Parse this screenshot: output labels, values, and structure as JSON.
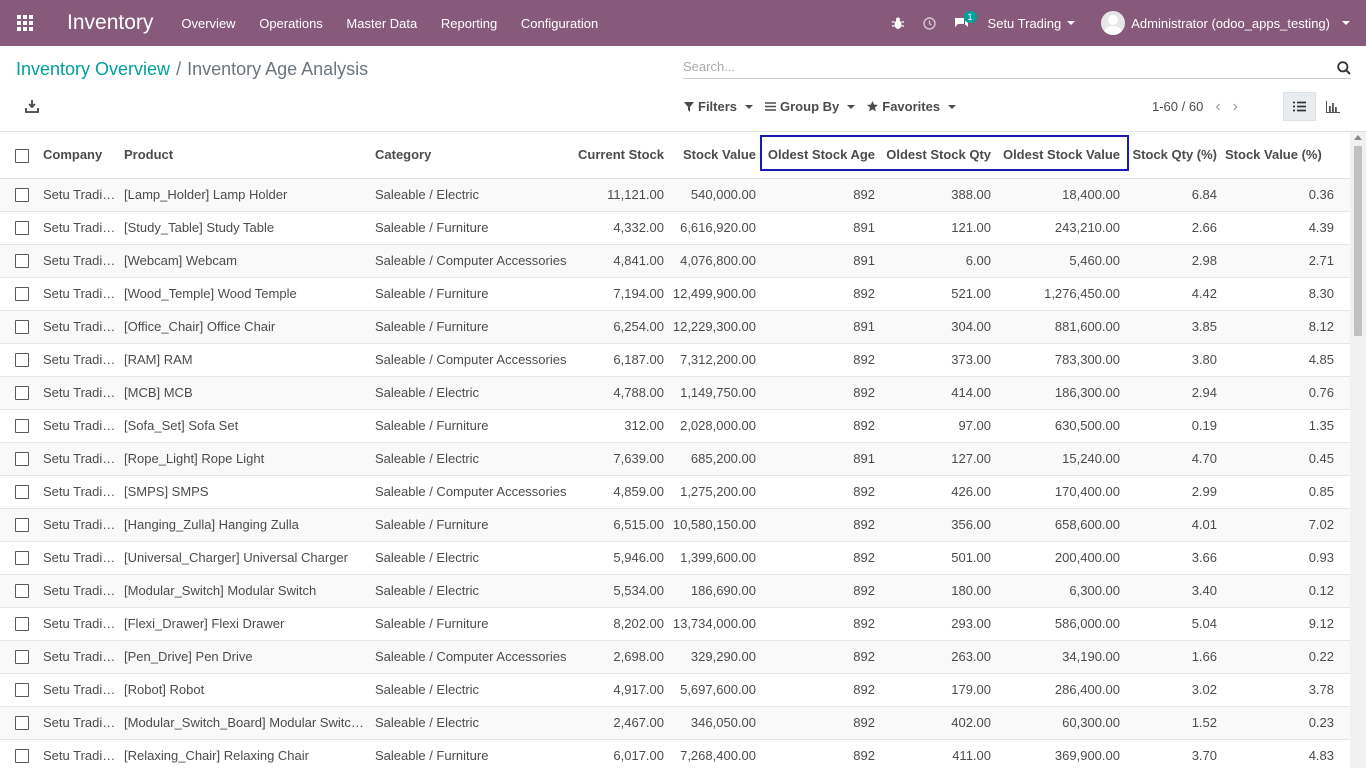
{
  "navbar": {
    "app_title": "Inventory",
    "menu": [
      "Overview",
      "Operations",
      "Master Data",
      "Reporting",
      "Configuration"
    ],
    "message_count": "1",
    "company": "Setu Trading",
    "user": "Administrator (odoo_apps_testing)"
  },
  "breadcrumb": {
    "parent": "Inventory Overview",
    "current": "Inventory Age Analysis"
  },
  "search": {
    "placeholder": "Search..."
  },
  "filters": {
    "filters_label": "Filters",
    "groupby_label": "Group By",
    "favorites_label": "Favorites"
  },
  "pager": {
    "value": "1-60 / 60"
  },
  "table": {
    "columns": [
      "Company",
      "Product",
      "Category",
      "Current Stock",
      "Stock Value",
      "Oldest Stock Age",
      "Oldest Stock Qty",
      "Oldest Stock Value",
      "Stock Qty (%)",
      "Stock Value (%)"
    ],
    "rows": [
      [
        "Setu Trading",
        "[Lamp_Holder] Lamp Holder",
        "Saleable / Electric",
        "11,121.00",
        "540,000.00",
        "892",
        "388.00",
        "18,400.00",
        "6.84",
        "0.36"
      ],
      [
        "Setu Trading",
        "[Study_Table] Study Table",
        "Saleable / Furniture",
        "4,332.00",
        "6,616,920.00",
        "891",
        "121.00",
        "243,210.00",
        "2.66",
        "4.39"
      ],
      [
        "Setu Trading",
        "[Webcam] Webcam",
        "Saleable / Computer Accessories",
        "4,841.00",
        "4,076,800.00",
        "891",
        "6.00",
        "5,460.00",
        "2.98",
        "2.71"
      ],
      [
        "Setu Trading",
        "[Wood_Temple] Wood Temple",
        "Saleable / Furniture",
        "7,194.00",
        "12,499,900.00",
        "892",
        "521.00",
        "1,276,450.00",
        "4.42",
        "8.30"
      ],
      [
        "Setu Trading",
        "[Office_Chair] Office Chair",
        "Saleable / Furniture",
        "6,254.00",
        "12,229,300.00",
        "891",
        "304.00",
        "881,600.00",
        "3.85",
        "8.12"
      ],
      [
        "Setu Trading",
        "[RAM] RAM",
        "Saleable / Computer Accessories",
        "6,187.00",
        "7,312,200.00",
        "892",
        "373.00",
        "783,300.00",
        "3.80",
        "4.85"
      ],
      [
        "Setu Trading",
        "[MCB] MCB",
        "Saleable / Electric",
        "4,788.00",
        "1,149,750.00",
        "892",
        "414.00",
        "186,300.00",
        "2.94",
        "0.76"
      ],
      [
        "Setu Trading",
        "[Sofa_Set] Sofa Set",
        "Saleable / Furniture",
        "312.00",
        "2,028,000.00",
        "892",
        "97.00",
        "630,500.00",
        "0.19",
        "1.35"
      ],
      [
        "Setu Trading",
        "[Rope_Light] Rope Light",
        "Saleable / Electric",
        "7,639.00",
        "685,200.00",
        "891",
        "127.00",
        "15,240.00",
        "4.70",
        "0.45"
      ],
      [
        "Setu Trading",
        "[SMPS] SMPS",
        "Saleable / Computer Accessories",
        "4,859.00",
        "1,275,200.00",
        "892",
        "426.00",
        "170,400.00",
        "2.99",
        "0.85"
      ],
      [
        "Setu Trading",
        "[Hanging_Zulla] Hanging Zulla",
        "Saleable / Furniture",
        "6,515.00",
        "10,580,150.00",
        "892",
        "356.00",
        "658,600.00",
        "4.01",
        "7.02"
      ],
      [
        "Setu Trading",
        "[Universal_Charger] Universal Charger",
        "Saleable / Electric",
        "5,946.00",
        "1,399,600.00",
        "892",
        "501.00",
        "200,400.00",
        "3.66",
        "0.93"
      ],
      [
        "Setu Trading",
        "[Modular_Switch] Modular Switch",
        "Saleable / Electric",
        "5,534.00",
        "186,690.00",
        "892",
        "180.00",
        "6,300.00",
        "3.40",
        "0.12"
      ],
      [
        "Setu Trading",
        "[Flexi_Drawer] Flexi Drawer",
        "Saleable / Furniture",
        "8,202.00",
        "13,734,000.00",
        "892",
        "293.00",
        "586,000.00",
        "5.04",
        "9.12"
      ],
      [
        "Setu Trading",
        "[Pen_Drive] Pen Drive",
        "Saleable / Computer Accessories",
        "2,698.00",
        "329,290.00",
        "892",
        "263.00",
        "34,190.00",
        "1.66",
        "0.22"
      ],
      [
        "Setu Trading",
        "[Robot] Robot",
        "Saleable / Electric",
        "4,917.00",
        "5,697,600.00",
        "892",
        "179.00",
        "286,400.00",
        "3.02",
        "3.78"
      ],
      [
        "Setu Trading",
        "[Modular_Switch_Board] Modular Switch Board",
        "Saleable / Electric",
        "2,467.00",
        "346,050.00",
        "892",
        "402.00",
        "60,300.00",
        "1.52",
        "0.23"
      ],
      [
        "Setu Trading",
        "[Relaxing_Chair] Relaxing Chair",
        "Saleable / Furniture",
        "6,017.00",
        "7,268,400.00",
        "892",
        "411.00",
        "369,900.00",
        "3.70",
        "4.83"
      ]
    ]
  },
  "colors": {
    "navbar": "#875a7b",
    "link": "#00a09d",
    "highlight_border": "#1a1ab8"
  }
}
